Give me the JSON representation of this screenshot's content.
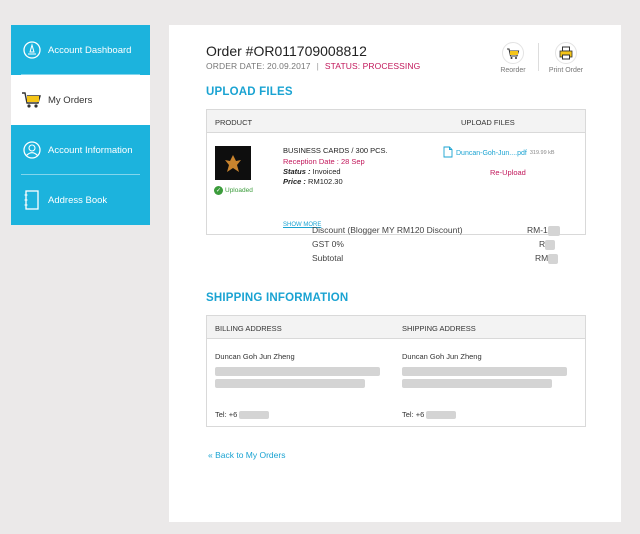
{
  "sidebar": {
    "items": [
      {
        "label": "Account Dashboard",
        "icon": "dashboard-icon"
      },
      {
        "label": "My Orders",
        "icon": "cart-icon"
      },
      {
        "label": "Account Information",
        "icon": "user-icon"
      },
      {
        "label": "Address Book",
        "icon": "address-book-icon"
      }
    ]
  },
  "order": {
    "title": "Order #OR011709008812",
    "date_label": "ORDER DATE: 20.09.2017",
    "separator": "|",
    "status_label": "STATUS: PROCESSING",
    "reorder_label": "Reorder",
    "print_label": "Print Order"
  },
  "upload": {
    "section_title": "UPLOAD FILES",
    "col_product": "PRODUCT",
    "col_upload": "UPLOAD FILES",
    "uploaded_label": "Uploaded",
    "product_name": "BUSINESS CARDS / 300 PCS.",
    "reception": "Reception Date : 28 Sep",
    "status_key": "Status :",
    "status_val": "Invoiced",
    "price_key": "Price :",
    "price_val": "RM102.30",
    "show_more": "SHOW MORE",
    "file_name": "Duncan-Goh-Jun....pdf",
    "file_size": "319.99 kB",
    "reupload": "Re-Upload"
  },
  "totals": {
    "rows": [
      {
        "label": "Discount (Blogger MY RM120 Discount)",
        "value": "RM-1"
      },
      {
        "label": "GST 0%",
        "value": "R"
      },
      {
        "label": "Subtotal",
        "value": "RM"
      }
    ]
  },
  "shipping": {
    "section_title": "SHIPPING INFORMATION",
    "col_billing": "BILLING ADDRESS",
    "col_shipping": "SHIPPING ADDRESS",
    "billing_name": "Duncan Goh Jun Zheng",
    "billing_tel": "Tel: +6",
    "shipping_name": "Duncan Goh Jun Zheng",
    "shipping_tel": "Tel: +6"
  },
  "back_link": "« Back to My Orders",
  "colors": {
    "accent": "#1cb3dd",
    "status": "#c2185b",
    "success": "#3c9c3c"
  }
}
